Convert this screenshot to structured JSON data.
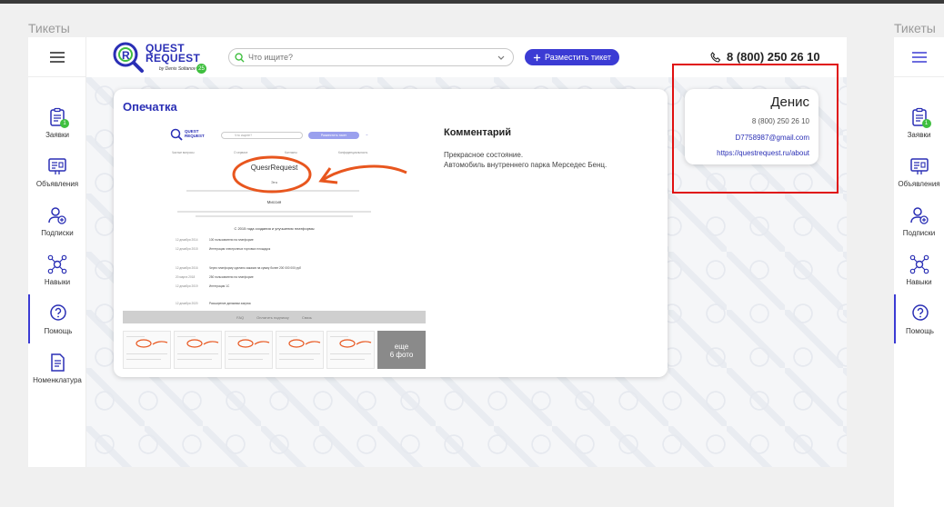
{
  "left_frame_label": "Тикеты",
  "right_frame_label": "Тикеты",
  "sidebar": {
    "items": [
      {
        "label": "Заявки",
        "badge": "1"
      },
      {
        "label": "Объявления"
      },
      {
        "label": "Подписки"
      },
      {
        "label": "Навыки"
      },
      {
        "label": "Помощь"
      },
      {
        "label": "Номенклатура"
      }
    ]
  },
  "header": {
    "logo_line1": "QUEST",
    "logo_line2": "REQUEST",
    "logo_sub": "by Denis Soltanov",
    "logo_badge": "25",
    "search_placeholder": "Что ищите?",
    "post_button": "Разместить тикет",
    "phone": "8 (800) 250 26 10"
  },
  "ticket": {
    "title": "Опечатка",
    "comment_title": "Комментарий",
    "comment_line1": "Прекрасное состояние.",
    "comment_line2": "Автомобиль внутреннего парка Мерседес Бенц.",
    "more_photos_line1": "еще",
    "more_photos_line2": "6 фото"
  },
  "screenshot_preview": {
    "logo_line1": "QUEST",
    "logo_line2": "REQUEST",
    "search_placeholder": "Что ищите?",
    "post_button": "Разместить тикет",
    "nav": [
      "Частые вопросы",
      "О сервисе",
      "Контакты",
      "Конфиденциальность"
    ],
    "brand_title": "QuesrRequest",
    "sub": "Это",
    "mission_label": "Миссия",
    "timeline_title": "С 2015 года создания и улучшения платформы",
    "timeline": [
      {
        "date": "12 декабря 2014",
        "text": "100 пользователи на платформе"
      },
      {
        "date": "12 декабря 2015",
        "text": "Интеграция электронных торговых площадок"
      },
      {
        "date": "12 декабря 2016",
        "text": "Через платформу сделано заказов на сумму более 200 000 000 руб"
      },
      {
        "date": "20 марта 2018",
        "text": "250 пользователи на платформе"
      },
      {
        "date": "12 декабря 2019",
        "text": "Интеграция 1С"
      },
      {
        "date": "12 декабря 2020",
        "text": "Расширение динамики закупок"
      }
    ],
    "footer": [
      "FAQ",
      "Оплатить подписку",
      "Связь"
    ]
  },
  "profile": {
    "name": "Денис",
    "phone": "8 (800) 250 26 10",
    "email": "D7758987@gmail.com",
    "url": "https://questrequest.ru/about"
  },
  "colors": {
    "accent": "#3b3bd4",
    "badge": "#3fbf3f",
    "annotation": "#e8561e",
    "highlight": "#e01010"
  }
}
